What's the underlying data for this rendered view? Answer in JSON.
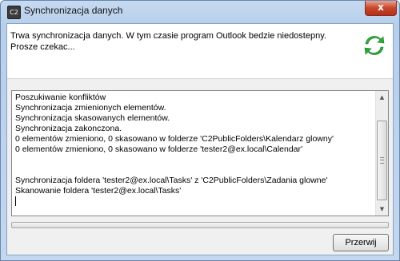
{
  "window": {
    "title": "Synchronizacja danych",
    "icon_text": "C2",
    "close_label": "x"
  },
  "header": {
    "message": "Trwa synchronizacja danych. W tym czasie program Outlook bedzie niedostepny.\nProsze czekac..."
  },
  "log": {
    "lines": [
      "Poszukiwanie konfliktów",
      "Synchronizacja zmienionych elementów.",
      "Synchronizacja skasowanych elementów.",
      "Synchronizacja zakonczona.",
      "0 elementów zmieniono, 0 skasowano w folderze 'C2PublicFolders\\Kalendarz glowny'",
      "0 elementów zmieniono, 0 skasowano w folderze 'tester2@ex.local\\Calendar'",
      "",
      "",
      "Synchronizacja foldera 'tester2@ex.local\\Tasks' z 'C2PublicFolders\\Zadania glowne'",
      "Skanowanie foldera 'tester2@ex.local\\Tasks'"
    ]
  },
  "progress": {
    "fraction": 0.0
  },
  "buttons": {
    "cancel_label": "Przerwij"
  },
  "colors": {
    "sync_green": "#2fa83a",
    "close_red": "#c7452b"
  }
}
